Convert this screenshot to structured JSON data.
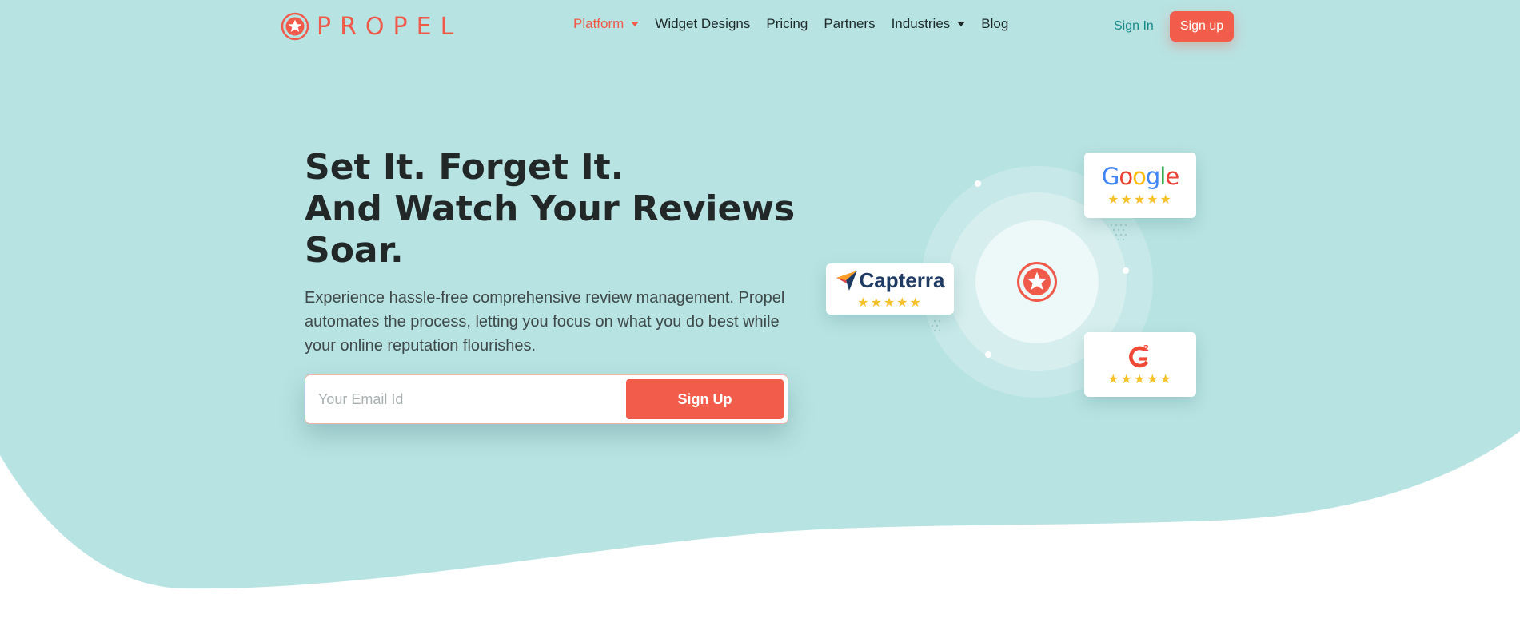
{
  "brand": {
    "name": "PROPEL",
    "color": "#f05a4a"
  },
  "colors": {
    "hero_bg": "#b8e3e3",
    "accent": "#f25c4a",
    "text_dark": "#222727",
    "link_teal": "#148a88",
    "star": "#f6c22c"
  },
  "nav": {
    "items": [
      {
        "label": "Platform",
        "dropdown": true,
        "active": true
      },
      {
        "label": "Widget Designs",
        "dropdown": false
      },
      {
        "label": "Pricing",
        "dropdown": false
      },
      {
        "label": "Partners",
        "dropdown": false
      },
      {
        "label": "Industries",
        "dropdown": true
      },
      {
        "label": "Blog",
        "dropdown": false
      }
    ],
    "sign_in": "Sign In",
    "sign_up": "Sign up"
  },
  "hero": {
    "headline": [
      "Set It. Forget It.",
      "And Watch Your Reviews",
      "Soar."
    ],
    "subtext": "Experience hassle-free comprehensive review management. Propel automates the process, letting you focus on what you do best while your online reputation flourishes.",
    "email_placeholder": "Your Email Id",
    "cta": "Sign Up"
  },
  "review_sites": [
    {
      "name": "Google",
      "stars": "★★★★★",
      "rating": 5
    },
    {
      "name": "Capterra",
      "stars": "★★★★★",
      "rating": 5
    },
    {
      "name": "G2",
      "stars": "★★★★★",
      "rating": 5
    }
  ]
}
